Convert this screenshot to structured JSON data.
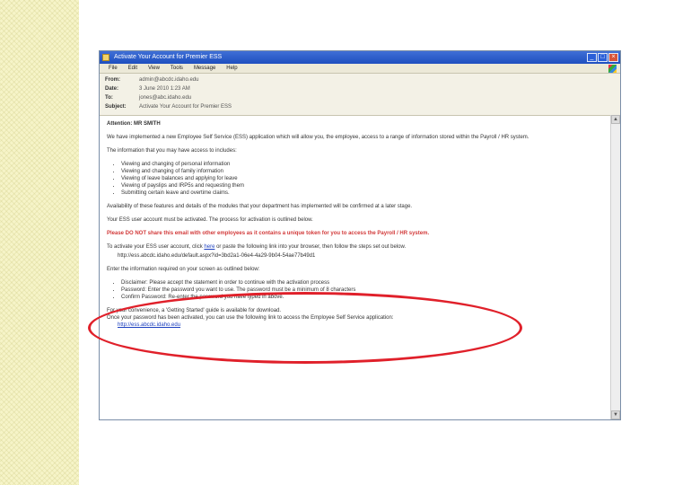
{
  "window": {
    "title": "Activate Your Account for Premier ESS",
    "controls": [
      "_",
      "□",
      "×"
    ]
  },
  "menu": {
    "items": [
      "File",
      "Edit",
      "View",
      "Tools",
      "Message",
      "Help"
    ]
  },
  "header": {
    "from_label": "From:",
    "from_value": "admin@abcdc.idaho.edu",
    "date_label": "Date:",
    "date_value": "3 June 2010 1:23 AM",
    "to_label": "To:",
    "to_value": "jones@abc.idaho.edu",
    "subject_label": "Subject:",
    "subject_value": "Activate Your Account for Premier ESS"
  },
  "body": {
    "attention": "Attention: MR SMITH",
    "intro": "We have implemented a new Employee Self Service (ESS) application which will allow you, the employee, access to a range of information stored within the Payroll / HR system.",
    "access_intro": "The information that you may have access to includes:",
    "access_items": [
      "Viewing and changing of personal information",
      "Viewing and changing of family information",
      "Viewing of leave balances and applying for leave",
      "Viewing of payslips and IRP5s and requesting them",
      "Submitting certain leave and overtime claims."
    ],
    "availability": "Availability of these features and details of the modules that your department has implemented will be confirmed at a later stage.",
    "activation_note": "Your ESS user account must be activated. The process for activation is outlined below.",
    "warning": "Please DO NOT share this email with other employees as it contains a unique token for you to access the Payroll / HR system.",
    "activate_pre": "To activate your ESS user account, click ",
    "activate_link_text": "here",
    "activate_post": " or paste the following link into your browser, then follow the steps set out below.",
    "activation_url": "http://ess.abcdc.idaho.edu/default.aspx?id=3bd2a1-06e4-4a29-9b04-54ae77b49d1",
    "enter_info": "Enter the information required on your screen as outlined below:",
    "steps": [
      "Disclaimer: Please accept the statement in order to continue with the activation process",
      "Password: Enter the password you want to use. The password must be a minimum of 8 characters",
      "Confirm Password: Re-enter the password you have typed in above."
    ],
    "guide_note": "For your convenience, a 'Getting Started' guide is available for download.",
    "closing": "Once your password has been activated, you can use the following link to access the Employee Self Service application:",
    "ess_url": "http://ess.abcdc.idaho.edu"
  }
}
